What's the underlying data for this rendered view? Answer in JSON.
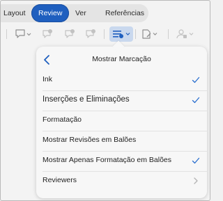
{
  "tabs": [
    {
      "label": "Layout",
      "active": false
    },
    {
      "label": "Review",
      "active": true
    },
    {
      "label": "Ver",
      "active": false
    },
    {
      "label": "Referências",
      "active": false
    }
  ],
  "toolbar": {
    "icons": [
      "comment-icon",
      "delete-comment-icon",
      "previous-comment-icon",
      "next-comment-icon",
      "markup-icon",
      "track-changes-icon",
      "protect-icon"
    ]
  },
  "popover": {
    "back_label": "<",
    "title": "Mostrar Marcação",
    "items": [
      {
        "label": "Ink",
        "checked": true
      },
      {
        "label": "Inserções e Eliminações",
        "checked": true
      },
      {
        "label": "Formatação",
        "checked": false
      },
      {
        "label": "Mostrar Revisões em Balões",
        "checked": false
      },
      {
        "label": "Mostrar Apenas Formatação em Balões",
        "checked": true
      },
      {
        "label": "Reviewers",
        "submenu": true
      }
    ]
  },
  "colors": {
    "accent": "#1f5fbf",
    "check": "#2a6fcf",
    "background": "#f3f3f3"
  }
}
